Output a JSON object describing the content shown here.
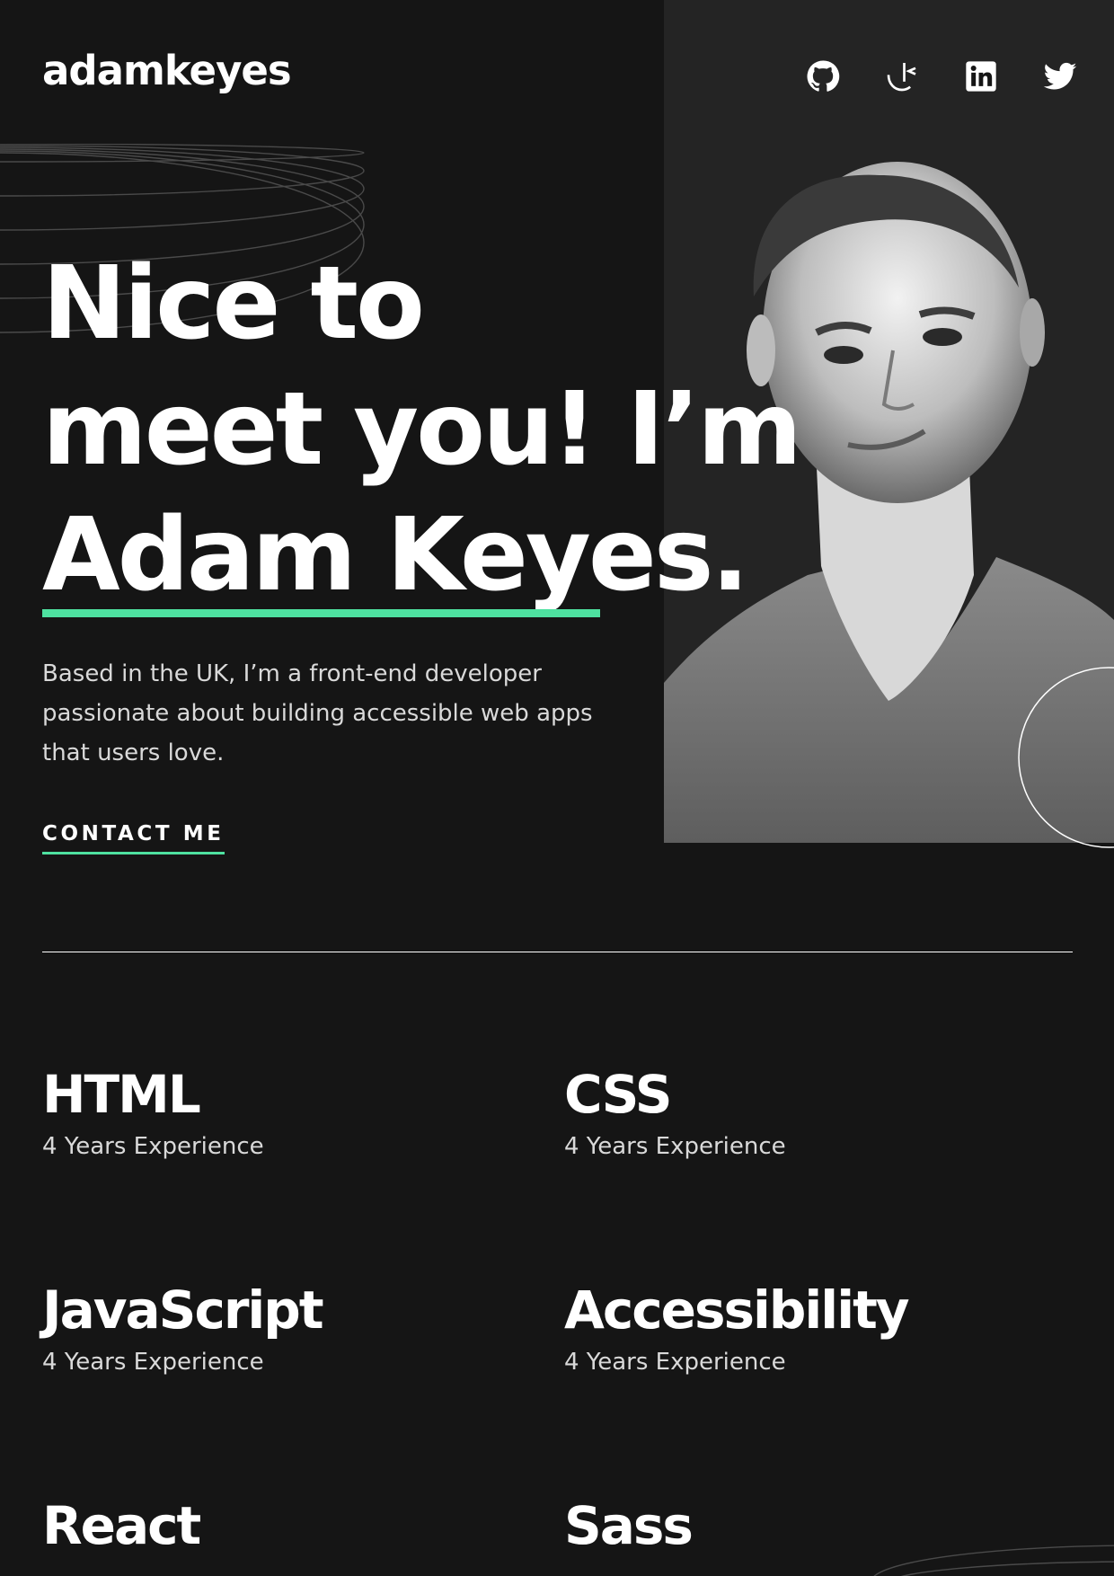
{
  "header": {
    "logo": "adamkeyes",
    "social_links": [
      {
        "icon": "github-icon"
      },
      {
        "icon": "frontend-mentor-icon"
      },
      {
        "icon": "linkedin-icon"
      },
      {
        "icon": "twitter-icon"
      }
    ]
  },
  "hero": {
    "title_lines": [
      "Nice to",
      "meet you! I’m",
      "Adam Keyes."
    ],
    "intro": "Based in the UK, I’m a front-end developer passionate about building accessible web apps that users love.",
    "cta_label": "CONTACT ME"
  },
  "skills": [
    {
      "name": "HTML",
      "experience": "4 Years Experience"
    },
    {
      "name": "CSS",
      "experience": "4 Years Experience"
    },
    {
      "name": "JavaScript",
      "experience": "4 Years Experience"
    },
    {
      "name": "Accessibility",
      "experience": "4 Years Experience"
    },
    {
      "name": "React",
      "experience": ""
    },
    {
      "name": "Sass",
      "experience": ""
    }
  ],
  "colors": {
    "background": "#151515",
    "panel": "#242424",
    "accent": "#4ee1a0",
    "text": "#ffffff",
    "muted_text": "#d9d9d9"
  }
}
